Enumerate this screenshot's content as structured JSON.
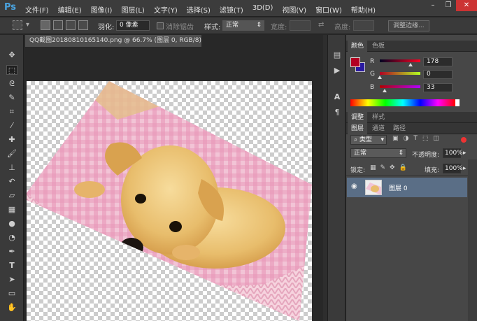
{
  "app": {
    "logo": "Ps",
    "menu": [
      "文件(F)",
      "编辑(E)",
      "图像(I)",
      "图层(L)",
      "文字(Y)",
      "选择(S)",
      "滤镜(T)",
      "3D(D)",
      "视图(V)",
      "窗口(W)",
      "帮助(H)"
    ],
    "window_controls": [
      "–",
      "❐",
      "✕"
    ]
  },
  "options": {
    "feather_label": "羽化:",
    "feather_value": "0 像素",
    "antialias_label": "消除锯齿",
    "style_label": "样式:",
    "style_value": "正常",
    "width_label": "宽度:",
    "height_label": "高度:",
    "refine_button": "调整边缘..."
  },
  "document": {
    "tab_title": "QQ截图20180810165140.png @ 66.7% (图层 0, RGB/8) *",
    "close": "×"
  },
  "color_panel": {
    "tabs": [
      "颜色",
      "色板"
    ],
    "channels": [
      {
        "label": "R",
        "value": "178"
      },
      {
        "label": "G",
        "value": "0"
      },
      {
        "label": "B",
        "value": "33"
      }
    ],
    "foreground": "#b20021",
    "background": "#2a1aa0"
  },
  "adjust_panel": {
    "tabs": [
      "调整",
      "样式"
    ]
  },
  "layers_panel": {
    "tabs": [
      "图层",
      "通道",
      "路径"
    ],
    "filter_value": "类型",
    "blend_mode": "正常",
    "opacity_label": "不透明度:",
    "opacity_value": "100%",
    "lock_label": "锁定:",
    "fill_label": "填充:",
    "fill_value": "100%",
    "layers": [
      {
        "name": "图层 0",
        "visible": true
      }
    ]
  }
}
